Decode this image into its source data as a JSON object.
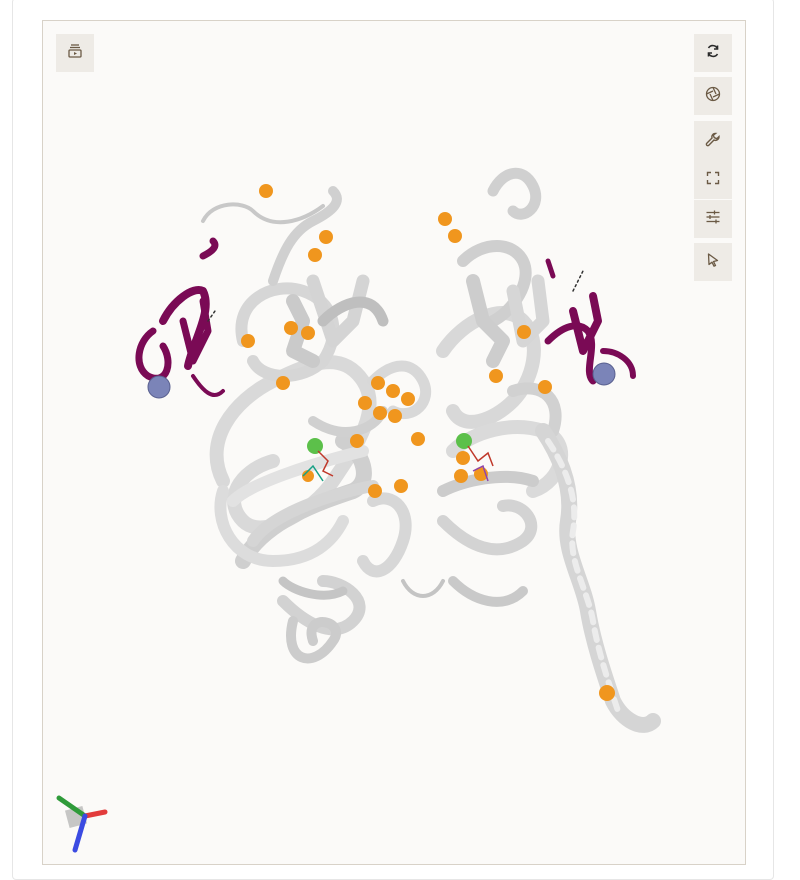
{
  "viewer": {
    "background": "#fbfaf8",
    "border_color": "#d8d2c8"
  },
  "toolbar_left": [
    {
      "name": "animation-toggle",
      "icon": "layers-play-icon"
    }
  ],
  "toolbar_right": [
    {
      "name": "reset-view",
      "icon": "refresh-icon"
    },
    {
      "name": "screenshot",
      "icon": "camera-aperture-icon"
    },
    {
      "name": "tools",
      "icon": "wrench-icon"
    },
    {
      "name": "fullscreen",
      "icon": "expand-icon"
    },
    {
      "name": "settings",
      "icon": "sliders-icon"
    },
    {
      "name": "selection-mode",
      "icon": "cursor-arrow-icon"
    }
  ],
  "structure": {
    "ribbon_color": "#d9d9d9",
    "ribbon_shade": "#bdbdbd",
    "highlight_chain_color": "#7a0a55",
    "ion_color_orange": "#f0961e",
    "ion_color_blue": "#7b84b8",
    "ion_color_green": "#5cc04a"
  },
  "axes_colors": {
    "x": "#e23b3b",
    "y": "#2f9b3a",
    "z": "#3b4be2"
  }
}
